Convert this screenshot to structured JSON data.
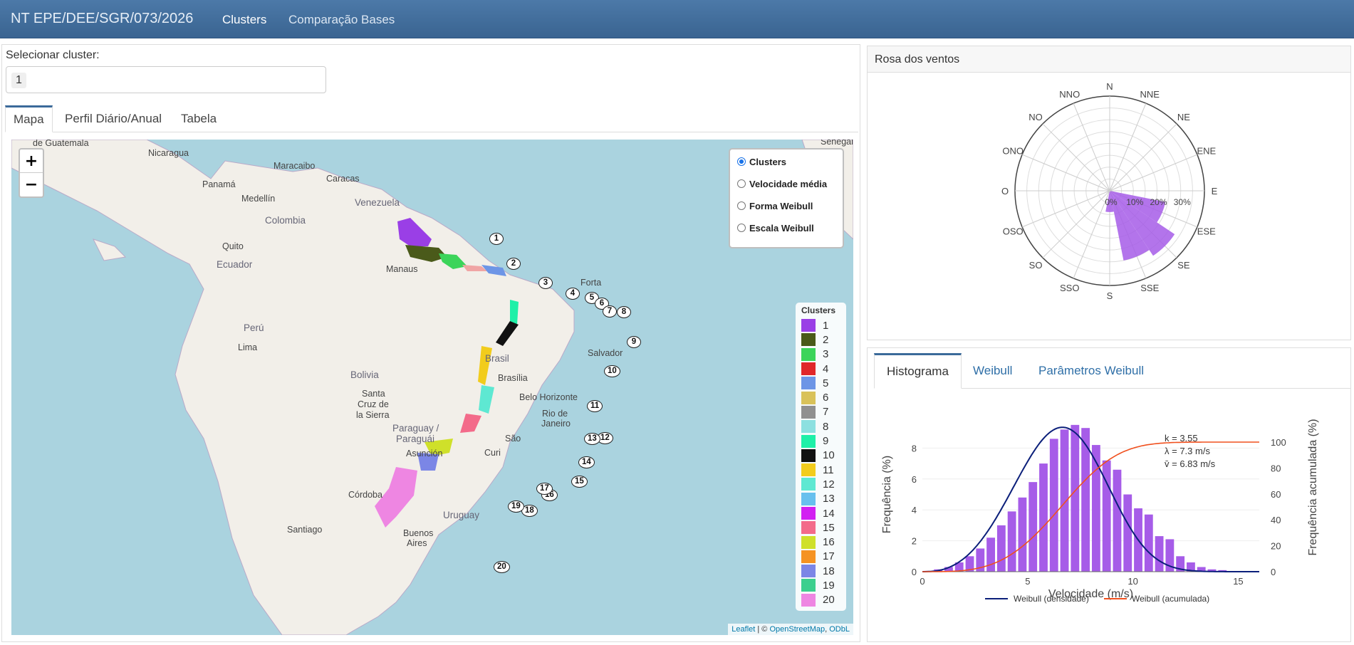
{
  "header": {
    "brand": "NT EPE/DEE/SGR/073/2026",
    "nav": [
      "Clusters",
      "Comparação Bases"
    ]
  },
  "left": {
    "select_label": "Selecionar cluster:",
    "select_value": "1",
    "tabs": [
      "Mapa",
      "Perfil Diário/Anual",
      "Tabela"
    ]
  },
  "map": {
    "zoom_in": "+",
    "zoom_out": "−",
    "layers": [
      "Clusters",
      "Velocidade média",
      "Forma Weibull",
      "Escala Weibull"
    ],
    "selected_layer": "Clusters",
    "legend_title": "Clusters",
    "legend": [
      {
        "label": "1",
        "color": "#9a3fe6"
      },
      {
        "label": "2",
        "color": "#4a5a1a"
      },
      {
        "label": "3",
        "color": "#3cd45a"
      },
      {
        "label": "4",
        "color": "#e0272a"
      },
      {
        "label": "5",
        "color": "#6d95e6"
      },
      {
        "label": "6",
        "color": "#d9c25a"
      },
      {
        "label": "7",
        "color": "#909090"
      },
      {
        "label": "8",
        "color": "#8de0e0"
      },
      {
        "label": "9",
        "color": "#1ff0a8"
      },
      {
        "label": "10",
        "color": "#111111"
      },
      {
        "label": "11",
        "color": "#f2cc1c"
      },
      {
        "label": "12",
        "color": "#5ee8d2"
      },
      {
        "label": "13",
        "color": "#68c0ee"
      },
      {
        "label": "14",
        "color": "#d21ff2"
      },
      {
        "label": "15",
        "color": "#f36b8a"
      },
      {
        "label": "16",
        "color": "#cfe02a"
      },
      {
        "label": "17",
        "color": "#f59322"
      },
      {
        "label": "18",
        "color": "#7b86e6"
      },
      {
        "label": "19",
        "color": "#3ccf8e"
      },
      {
        "label": "20",
        "color": "#ee86e2"
      }
    ],
    "place_labels": [
      "de Guatemala",
      "Nicaragua",
      "Panamá",
      "Maracaibo",
      "Caracas",
      "Medellín",
      "Venezuela",
      "Colombia",
      "Quito",
      "Ecuador",
      "Manaus",
      "Perú",
      "Lima",
      "Brasil",
      "Bolivia",
      "Brasília",
      "Santa",
      "Cruz de",
      "la Sierra",
      "Belo Horizonte",
      "Rio de",
      "Janeiro",
      "Paraguay /",
      "Paraguái",
      "Asunción",
      "São",
      "Curi",
      "Córdoba",
      "Uruguay",
      "Santiago",
      "Buenos",
      "Aires",
      "Salvador",
      "Forta",
      "Senegal"
    ],
    "attribution_leaflet": "Leaflet",
    "attribution_sep": " | © ",
    "attribution_osm": "OpenStreetMap",
    "attribution_sep2": ", ",
    "attribution_odbl": "ODbL"
  },
  "rose": {
    "title": "Rosa dos ventos",
    "directions": [
      "N",
      "NNE",
      "NE",
      "ENE",
      "E",
      "ESE",
      "SE",
      "SSE",
      "S",
      "SSO",
      "SO",
      "OSO",
      "O",
      "ONO",
      "NO",
      "NNO"
    ],
    "radial_ticks": [
      "0%",
      "10%",
      "20%",
      "30%"
    ],
    "values_pct": [
      0,
      0,
      0,
      0,
      0,
      24,
      33,
      30,
      9,
      0,
      0,
      0,
      0,
      0,
      0,
      0
    ],
    "color": "#a65ce8"
  },
  "hist": {
    "tabs": [
      "Histograma",
      "Weibull",
      "Parâmetros Weibull"
    ],
    "params": [
      "k = 3.55",
      "λ = 7.3 m/s",
      "v̄ = 6.83 m/s"
    ],
    "legend_density": "Weibull (densidade)",
    "legend_cum": "Weibull (acumulada)"
  },
  "chart_data": {
    "type": "bar",
    "xlabel": "Velocidade (m/s)",
    "ylabel": "Frequência (%)",
    "y2label": "Frequência acumulada (%)",
    "xlim": [
      0,
      16
    ],
    "ylim": [
      0,
      10
    ],
    "y2lim": [
      0,
      100
    ],
    "xticks": [
      "0",
      "5",
      "10",
      "15"
    ],
    "yticks": [
      "0",
      "2",
      "4",
      "6",
      "8"
    ],
    "y2ticks": [
      "0",
      "20",
      "40",
      "60",
      "80",
      "100"
    ],
    "bin_width": 0.5,
    "bin_centers": [
      0.25,
      0.75,
      1.25,
      1.75,
      2.25,
      2.75,
      3.25,
      3.75,
      4.25,
      4.75,
      5.25,
      5.75,
      6.25,
      6.75,
      7.25,
      7.75,
      8.25,
      8.75,
      9.25,
      9.75,
      10.25,
      10.75,
      11.25,
      11.75,
      12.25,
      12.75,
      13.25,
      13.75,
      14.25
    ],
    "values": [
      0.05,
      0.15,
      0.3,
      0.6,
      1.0,
      1.5,
      2.2,
      3.0,
      3.9,
      4.8,
      5.8,
      7.0,
      8.6,
      9.2,
      9.5,
      9.3,
      8.2,
      7.2,
      6.6,
      5.0,
      4.1,
      3.7,
      2.3,
      2.1,
      1.0,
      0.6,
      0.3,
      0.15,
      0.1
    ],
    "series": [
      {
        "name": "Weibull (densidade)",
        "color": "#0b1f7a",
        "k": 3.55,
        "lambda": 7.3
      },
      {
        "name": "Weibull (acumulada)",
        "color": "#f0501e",
        "k": 3.55,
        "lambda": 7.3
      }
    ],
    "bar_color": "#a65ce8"
  }
}
